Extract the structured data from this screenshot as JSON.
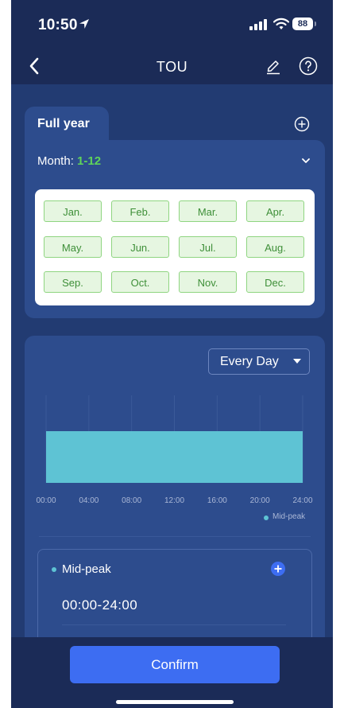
{
  "status_bar": {
    "time": "10:50",
    "battery": "88",
    "icons": [
      "location-arrow-icon",
      "signal-icon",
      "wifi-icon",
      "battery-icon"
    ]
  },
  "nav": {
    "title": "TOU",
    "icons": [
      "back-icon",
      "edit-icon",
      "help-icon"
    ]
  },
  "plan": {
    "tab_label": "Full year",
    "month_label": "Month:",
    "month_value": "1-12",
    "months": [
      "Jan.",
      "Feb.",
      "Mar.",
      "Apr.",
      "May.",
      "Jun.",
      "Jul.",
      "Aug.",
      "Sep.",
      "Oct.",
      "Nov.",
      "Dec."
    ]
  },
  "schedule": {
    "day_selector": "Every Day",
    "legend": "Mid-peak",
    "period": {
      "name": "Mid-peak",
      "range": "00:00-24:00"
    }
  },
  "colors": {
    "background": "#1b2b57",
    "card": "#2d4c8d",
    "accent": "#3d6df2",
    "mid_peak": "#5ec3d4",
    "month_selected": "#5fd35a"
  },
  "chart_data": {
    "type": "bar",
    "x_ticks": [
      "00:00",
      "04:00",
      "08:00",
      "12:00",
      "16:00",
      "20:00",
      "24:00"
    ],
    "xlim": [
      0,
      24
    ],
    "series": [
      {
        "name": "Mid-peak",
        "start": 0,
        "end": 24
      }
    ],
    "grid": true,
    "legend_position": "bottom-right"
  },
  "footer": {
    "confirm_label": "Confirm"
  }
}
